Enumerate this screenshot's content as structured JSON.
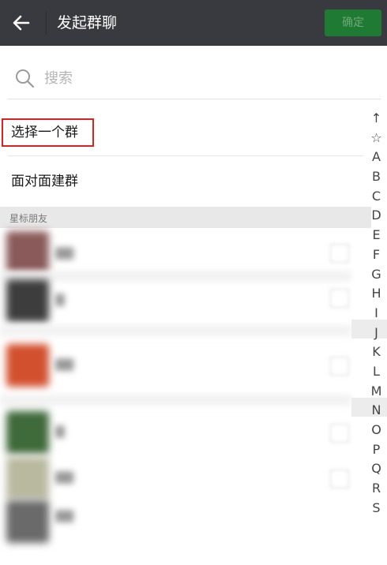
{
  "header": {
    "title": "发起群聊",
    "confirm_label": "确定"
  },
  "search": {
    "placeholder": "搜索",
    "value": ""
  },
  "options": [
    {
      "label": "选择一个群"
    },
    {
      "label": "面对面建群"
    }
  ],
  "section": {
    "label": "星标朋友"
  },
  "index_letters": [
    "↑",
    "☆",
    "A",
    "B",
    "C",
    "D",
    "E",
    "F",
    "G",
    "H",
    "I",
    "J",
    "K",
    "L",
    "M",
    "N",
    "O",
    "P",
    "Q",
    "R",
    "S"
  ],
  "colors": {
    "header_bg": "#393a3f",
    "confirm_bg": "#1f7b33",
    "highlight_border": "#e02020"
  }
}
